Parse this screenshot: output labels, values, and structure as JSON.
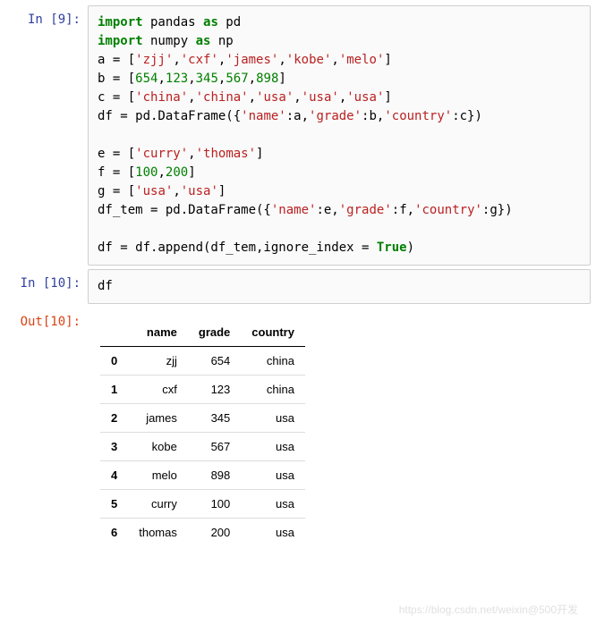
{
  "prompts": {
    "in9": "In  [9]:",
    "in10": "In [10]:",
    "out10": "Out[10]:"
  },
  "cell10_input": "df",
  "code": {
    "l1_kw1": "import",
    "l1_mod": " pandas ",
    "l1_kw2": "as",
    "l1_alias": " pd",
    "l2_kw1": "import",
    "l2_mod": " numpy ",
    "l2_kw2": "as",
    "l2_alias": " np",
    "l3_p1": "a = [",
    "l3_s1": "'zjj'",
    "l3_c1": ",",
    "l3_s2": "'cxf'",
    "l3_c2": ",",
    "l3_s3": "'james'",
    "l3_c3": ",",
    "l3_s4": "'kobe'",
    "l3_c4": ",",
    "l3_s5": "'melo'",
    "l3_p2": "]",
    "l4_p1": "b = [",
    "l4_n1": "654",
    "l4_c1": ",",
    "l4_n2": "123",
    "l4_c2": ",",
    "l4_n3": "345",
    "l4_c3": ",",
    "l4_n4": "567",
    "l4_c4": ",",
    "l4_n5": "898",
    "l4_p2": "]",
    "l5_p1": "c = [",
    "l5_s1": "'china'",
    "l5_c1": ",",
    "l5_s2": "'china'",
    "l5_c2": ",",
    "l5_s3": "'usa'",
    "l5_c3": ",",
    "l5_s4": "'usa'",
    "l5_c4": ",",
    "l5_s5": "'usa'",
    "l5_p2": "]",
    "l6_p1": "df = pd.DataFrame({",
    "l6_s1": "'name'",
    "l6_p2": ":a,",
    "l6_s2": "'grade'",
    "l6_p3": ":b,",
    "l6_s3": "'country'",
    "l6_p4": ":c})",
    "l8_p1": "e = [",
    "l8_s1": "'curry'",
    "l8_c1": ",",
    "l8_s2": "'thomas'",
    "l8_p2": "]",
    "l9_p1": "f = [",
    "l9_n1": "100",
    "l9_c1": ",",
    "l9_n2": "200",
    "l9_p2": "]",
    "l10_p1": "g = [",
    "l10_s1": "'usa'",
    "l10_c1": ",",
    "l10_s2": "'usa'",
    "l10_p2": "]",
    "l11_p1": "df_tem = pd.DataFrame({",
    "l11_s1": "'name'",
    "l11_p2": ":e,",
    "l11_s2": "'grade'",
    "l11_p3": ":f,",
    "l11_s3": "'country'",
    "l11_p4": ":g})",
    "l13_p1": "df = df.append(df_tem,ignore_index = ",
    "l13_kw": "True",
    "l13_p2": ")"
  },
  "chart_data": {
    "type": "table",
    "columns": [
      "name",
      "grade",
      "country"
    ],
    "index": [
      "0",
      "1",
      "2",
      "3",
      "4",
      "5",
      "6"
    ],
    "rows": [
      {
        "idx": "0",
        "name": "zjj",
        "grade": "654",
        "country": "china"
      },
      {
        "idx": "1",
        "name": "cxf",
        "grade": "123",
        "country": "china"
      },
      {
        "idx": "2",
        "name": "james",
        "grade": "345",
        "country": "usa"
      },
      {
        "idx": "3",
        "name": "kobe",
        "grade": "567",
        "country": "usa"
      },
      {
        "idx": "4",
        "name": "melo",
        "grade": "898",
        "country": "usa"
      },
      {
        "idx": "5",
        "name": "curry",
        "grade": "100",
        "country": "usa"
      },
      {
        "idx": "6",
        "name": "thomas",
        "grade": "200",
        "country": "usa"
      }
    ]
  },
  "watermark": "https://blog.csdn.net/weixin@500开发"
}
